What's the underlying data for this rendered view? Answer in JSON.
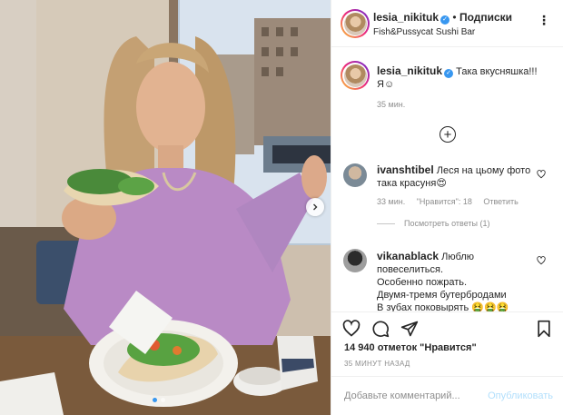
{
  "post": {
    "username": "lesia_nikituk",
    "follow_label": "Подписки",
    "location": "Fish&Pussycat Sushi Bar",
    "caption_line1": "Така вкусняшка!!!",
    "caption_line2": "Я☺",
    "caption_time": "35 мин."
  },
  "comments": [
    {
      "username": "ivanshtibel",
      "text1": "Леся на цьому фото",
      "text2": "така красуня",
      "emoji": "😍",
      "time": "33 мин.",
      "likes": "\"Нравится\": 18",
      "reply": "Ответить",
      "show_replies": "Посмотреть ответы (1)"
    },
    {
      "username": "vikanablack",
      "text1": "Люблю",
      "text2": "повеселиться.",
      "text3": "Особенно пожрать.",
      "text4": "Двумя-тремя бутербродами",
      "text5": "В зубах поковырять",
      "emoji": "🤮🤮🤮"
    }
  ],
  "stats": {
    "likes": "14 940 отметок \"Нравится\"",
    "time_ago": "35 МИНУТ НАЗАД"
  },
  "composer": {
    "placeholder": "Добавьте комментарий...",
    "publish": "Опубликовать"
  },
  "icons": [
    "more-icon",
    "heart-icon",
    "comment-icon",
    "share-icon",
    "bookmark-icon",
    "plus-icon",
    "chevron-right-icon"
  ],
  "colors": {
    "verified": "#3897f0",
    "publish_disabled": "#b2dffc",
    "muted": "#8e8e8e"
  }
}
